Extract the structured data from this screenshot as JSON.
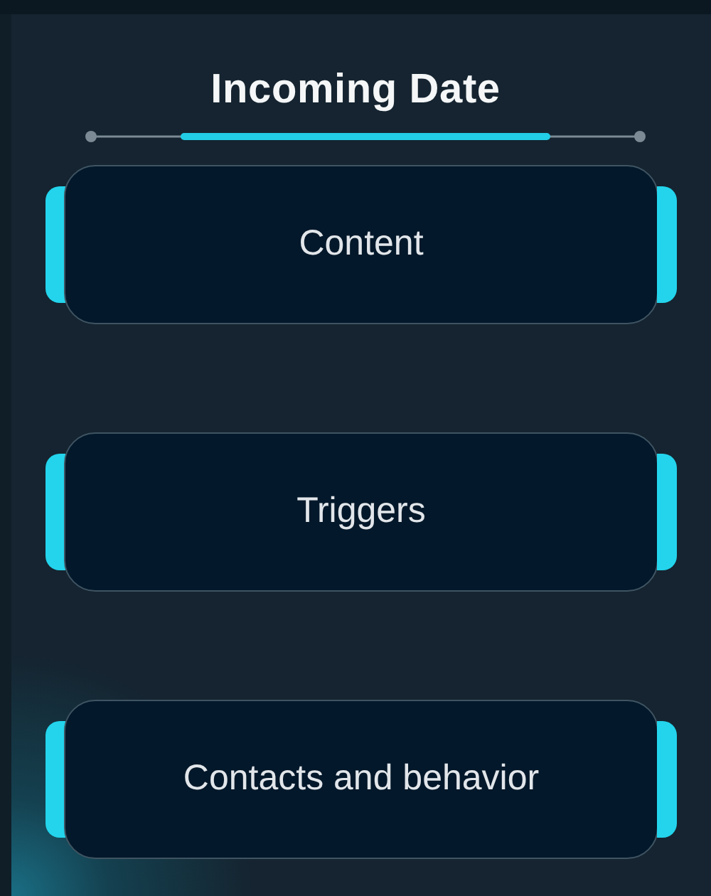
{
  "title": "Incoming Date",
  "menu": [
    {
      "label": "Content"
    },
    {
      "label": "Triggers"
    },
    {
      "label": "Contacts and behavior"
    }
  ]
}
